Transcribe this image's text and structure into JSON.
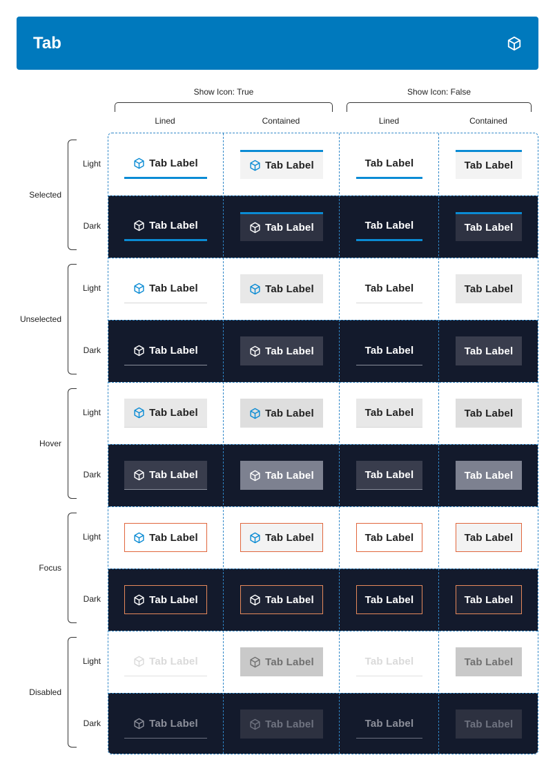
{
  "header": {
    "title": "Tab",
    "logo_icon": "hexagon-cube-icon",
    "bg": "#0079bd"
  },
  "groups": [
    {
      "label": "Show Icon: True",
      "columns": [
        "Lined",
        "Contained"
      ]
    },
    {
      "label": "Show Icon: False",
      "columns": [
        "Lined",
        "Contained"
      ]
    }
  ],
  "states": [
    {
      "name": "Selected",
      "modes": [
        "Light",
        "Dark"
      ]
    },
    {
      "name": "Unselected",
      "modes": [
        "Light",
        "Dark"
      ]
    },
    {
      "name": "Hover",
      "modes": [
        "Light",
        "Dark"
      ]
    },
    {
      "name": "Focus",
      "modes": [
        "Light",
        "Dark"
      ]
    },
    {
      "name": "Disabled",
      "modes": [
        "Light",
        "Dark"
      ]
    }
  ],
  "tab_label": "Tab Label",
  "tab_icon": "hexagon-cube-icon",
  "colors": {
    "accent": "#0a8bd4",
    "focus_border": "#e0643a",
    "dark_bg": "#131a2c",
    "grid_dash": "#2f87c8"
  }
}
